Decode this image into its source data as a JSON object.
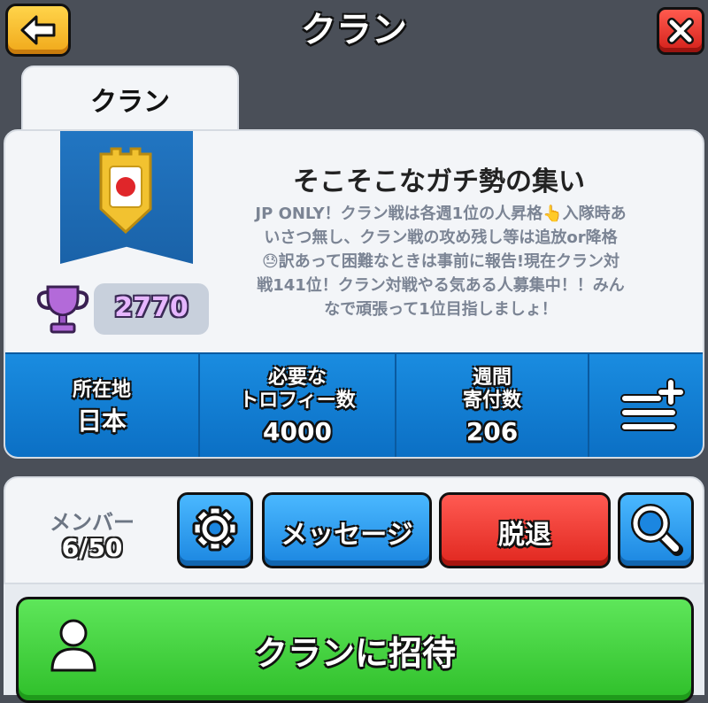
{
  "header": {
    "title": "クラン",
    "back_icon": "arrow-left-icon",
    "close_icon": "close-icon"
  },
  "tab": {
    "label": "クラン"
  },
  "clan": {
    "name": "そこそこなガチ勢の集い",
    "description": "JP ONLY！クラン戦は各週1位の人昇格👆入隊時あ\nいさつ無し、クラン戦の攻め残し等は追放or降格\n😓訳あって困難なときは事前に報告!現在クラン対\n戦141位！クラン対戦やる気ある人募集中！！みん\nなで頑張って1位目指しましょ！",
    "trophies": "2770",
    "badge_icon": "clan-badge-japan-flag-icon"
  },
  "stats": [
    {
      "label": "所在地",
      "value": "日本"
    },
    {
      "label": "必要な\nトロフィー数",
      "value": "4000"
    },
    {
      "label": "週間\n寄付数",
      "value": "206"
    }
  ],
  "members": {
    "label": "メンバー",
    "count": "6/50"
  },
  "actions": {
    "message_label": "メッセージ",
    "leave_label": "脱退"
  },
  "invite": {
    "label": "クランに招待"
  },
  "colors": {
    "back_button": "#f0a81a",
    "close_button": "#d2201a",
    "stats_bar": "#0b6fc4",
    "blue_button": "#1b86e0",
    "leave_button": "#e0271f",
    "invite_button": "#2fbf2a",
    "trophy": "#b36ad9"
  }
}
